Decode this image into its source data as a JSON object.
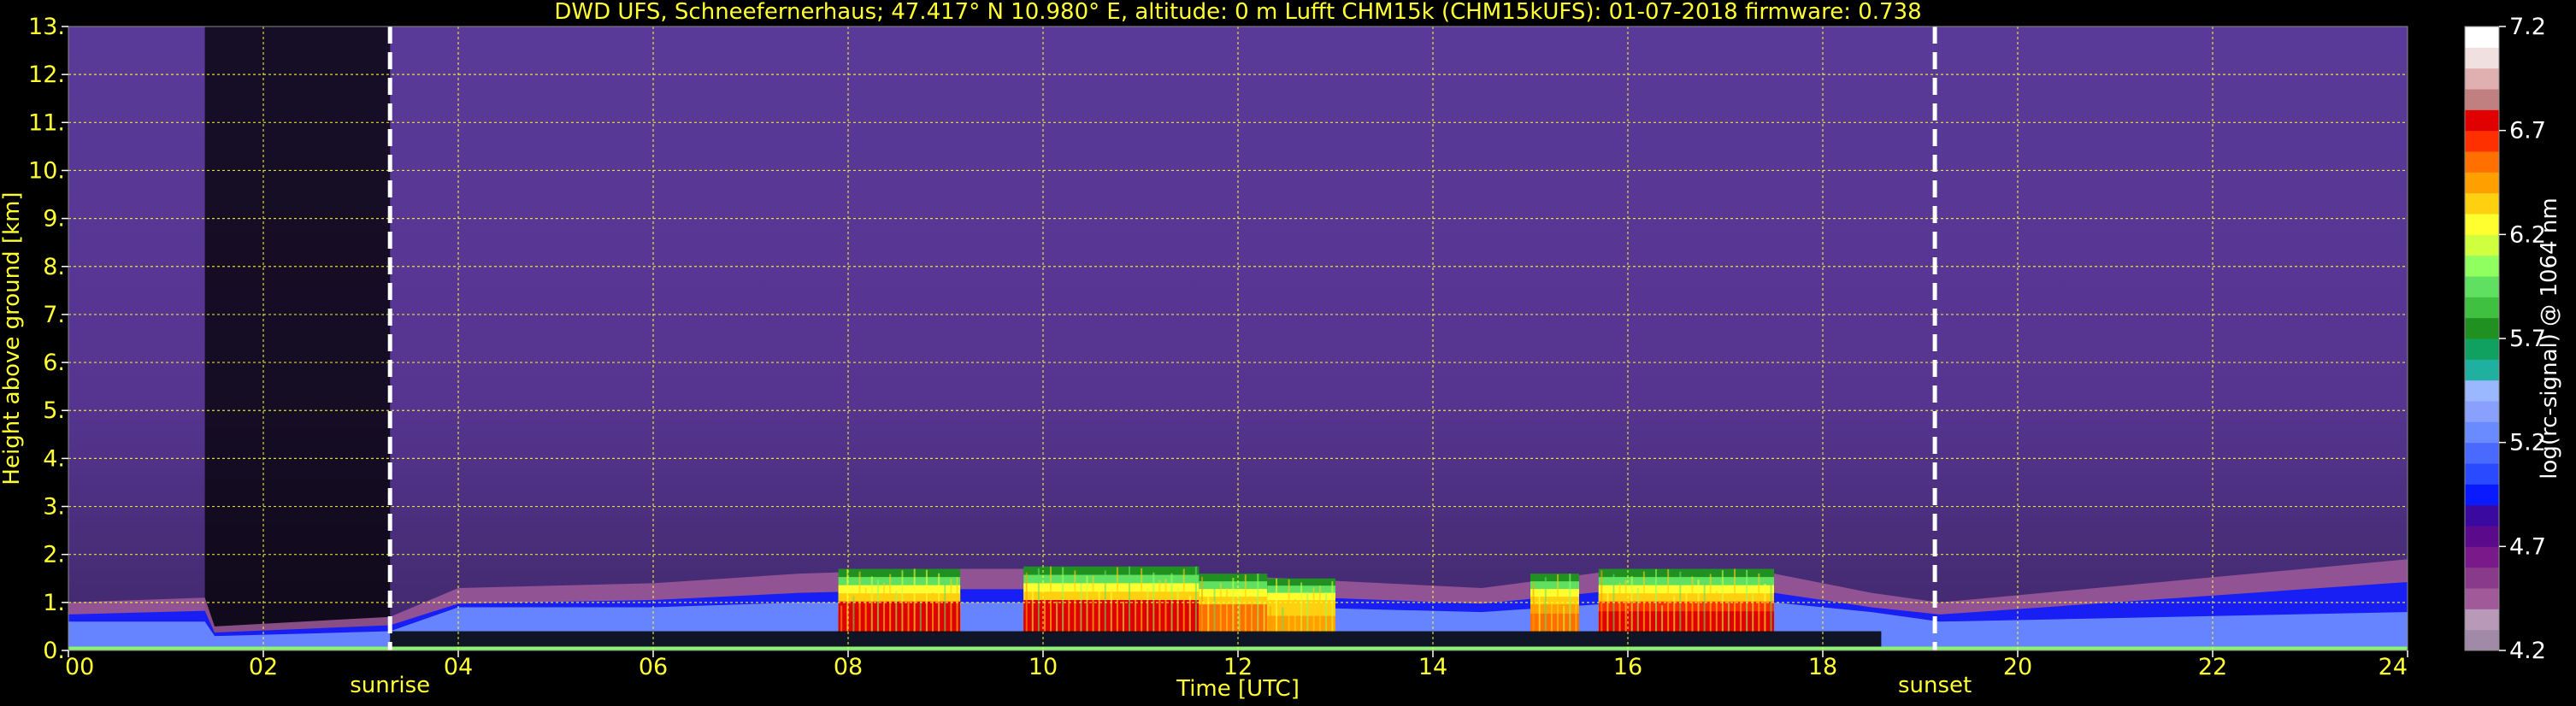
{
  "chart_data": {
    "type": "heatmap",
    "title": "DWD UFS, Schneefernerhaus; 47.417° N 10.980° E, altitude: 0 m    Lufft CHM15k (CHM15kUFS): 01-07-2018    firmware: 0.738",
    "xlabel": "Time [UTC]",
    "ylabel": "Height above ground [km]",
    "xlim": [
      0,
      24
    ],
    "ylim": [
      0,
      13
    ],
    "x_ticks": [
      "00",
      "02",
      "04",
      "06",
      "08",
      "10",
      "12",
      "14",
      "16",
      "18",
      "20",
      "22",
      "24"
    ],
    "y_ticks": [
      "0.",
      "1.",
      "2.",
      "3.",
      "4.",
      "5.",
      "6.",
      "7.",
      "8.",
      "9.",
      "10.",
      "11.",
      "12.",
      "13."
    ],
    "grid": true,
    "events": [
      {
        "label": "sunrise",
        "time": 3.3
      },
      {
        "label": "sunset",
        "time": 19.15
      }
    ],
    "colorbar": {
      "label": "log(rc-signal) @ 1064 nm",
      "range": [
        4.2,
        7.2
      ],
      "ticks": [
        "4.2",
        "4.7",
        "5.2",
        "5.7",
        "6.2",
        "6.7",
        "7.2"
      ],
      "colors": [
        "#a08aa8",
        "#b89ab8",
        "#a05a9a",
        "#8a3a8a",
        "#7a1a8a",
        "#5a0a8a",
        "#3a0aa0",
        "#0a1aff",
        "#2a4aff",
        "#4a6aff",
        "#6a8aff",
        "#8aa0ff",
        "#9ab8ff",
        "#20b0a0",
        "#10a060",
        "#209020",
        "#40c040",
        "#60e060",
        "#90ff60",
        "#d0ff40",
        "#ffff30",
        "#ffd010",
        "#ffa000",
        "#ff7000",
        "#ff3000",
        "#e00000",
        "#c08080",
        "#e0b0b0",
        "#f0e0e0",
        "#ffffff"
      ]
    },
    "mixing_layer_height_km": [
      {
        "t": 0.0,
        "top": 1.0,
        "core": 0.6
      },
      {
        "t": 1.4,
        "top": 1.1,
        "core": 0.6
      },
      {
        "t": 1.5,
        "top": 0.5,
        "core": 0.3
      },
      {
        "t": 3.3,
        "top": 0.7,
        "core": 0.4
      },
      {
        "t": 4.0,
        "top": 1.3,
        "core": 0.9
      },
      {
        "t": 6.0,
        "top": 1.4,
        "core": 0.9
      },
      {
        "t": 7.5,
        "top": 1.6,
        "core": 1.0
      },
      {
        "t": 9.0,
        "top": 1.7,
        "core": 1.0
      },
      {
        "t": 10.5,
        "top": 1.7,
        "core": 1.0
      },
      {
        "t": 12.5,
        "top": 1.5,
        "core": 0.9
      },
      {
        "t": 14.5,
        "top": 1.3,
        "core": 0.8
      },
      {
        "t": 16.0,
        "top": 1.7,
        "core": 1.0
      },
      {
        "t": 17.5,
        "top": 1.6,
        "core": 1.0
      },
      {
        "t": 18.5,
        "top": 1.2,
        "core": 0.8
      },
      {
        "t": 19.2,
        "top": 1.0,
        "core": 0.6
      },
      {
        "t": 24.0,
        "top": 1.9,
        "core": 0.8
      }
    ],
    "bright_segments": [
      {
        "start": 7.9,
        "end": 9.15,
        "top": 1.7,
        "max": 6.8
      },
      {
        "start": 9.8,
        "end": 11.6,
        "top": 1.75,
        "max": 6.8
      },
      {
        "start": 11.6,
        "end": 12.3,
        "top": 1.6,
        "max": 6.6
      },
      {
        "start": 12.3,
        "end": 13.0,
        "top": 1.5,
        "max": 6.4
      },
      {
        "start": 15.0,
        "end": 15.5,
        "top": 1.6,
        "max": 6.5
      },
      {
        "start": 15.7,
        "end": 17.5,
        "top": 1.7,
        "max": 6.7
      }
    ]
  }
}
